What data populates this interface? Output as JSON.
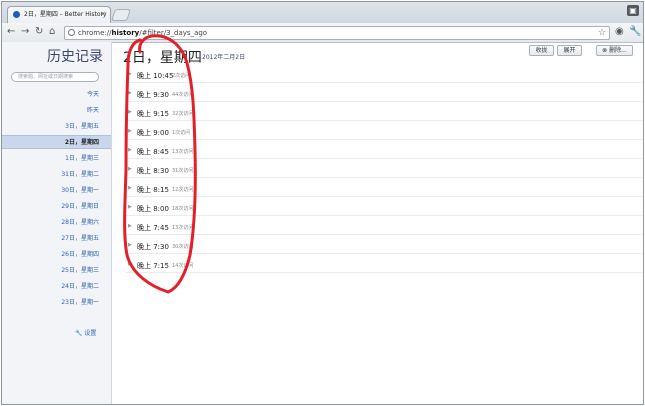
{
  "browser": {
    "tab_title": "2日，星期四 – Better History",
    "tab_close": "×",
    "url_prefix": "chrome://",
    "url_bold": "history",
    "url_suffix": "/#filter/3_days_ago",
    "corner_glyph": "▣"
  },
  "sidebar": {
    "title": "历史记录",
    "search_placeholder": "搜索题、网址或日期搜索",
    "items": [
      {
        "label": "今天"
      },
      {
        "label": "昨天"
      },
      {
        "label": "3日，星期五"
      },
      {
        "label": "2日，星期四",
        "selected": true
      },
      {
        "label": "1日，星期三"
      },
      {
        "label": "31日，星期二"
      },
      {
        "label": "30日，星期一"
      },
      {
        "label": "29日，星期日"
      },
      {
        "label": "28日，星期六"
      },
      {
        "label": "27日，星期五"
      },
      {
        "label": "26日，星期四"
      },
      {
        "label": "25日，星期三"
      },
      {
        "label": "24日，星期二"
      },
      {
        "label": "23日，星期一"
      }
    ],
    "settings_label": "设置"
  },
  "main": {
    "title": "2日，星期四",
    "date": "2012年二月2日",
    "collapse_label": "收拢",
    "expand_label": "展开",
    "delete_label": "删除..."
  },
  "entries": [
    {
      "time": "晚上 10:45",
      "count": "2次访问"
    },
    {
      "time": "晚上 9:30",
      "count": "44次访问"
    },
    {
      "time": "晚上 9:15",
      "count": "32次访问"
    },
    {
      "time": "晚上 9:00",
      "count": "1次访问"
    },
    {
      "time": "晚上 8:45",
      "count": "13次访问"
    },
    {
      "time": "晚上 8:30",
      "count": "31次访问"
    },
    {
      "time": "晚上 8:15",
      "count": "12次访问"
    },
    {
      "time": "晚上 8:00",
      "count": "18次访问"
    },
    {
      "time": "晚上 7:45",
      "count": "13次访问"
    },
    {
      "time": "晚上 7:30",
      "count": "30次访问"
    },
    {
      "time": "晚上 7:15",
      "count": "14次访问"
    }
  ],
  "colors": {
    "annotation": "#e3202a",
    "link": "#2b62b6",
    "selected_bg": "#c8d7ee"
  },
  "icons": [
    "back-icon",
    "forward-icon",
    "reload-icon",
    "home-icon",
    "page-icon",
    "star-icon",
    "chrome-icon",
    "wrench-icon",
    "expand-arrow-icon",
    "wrench-settings-icon",
    "delete-icon"
  ]
}
